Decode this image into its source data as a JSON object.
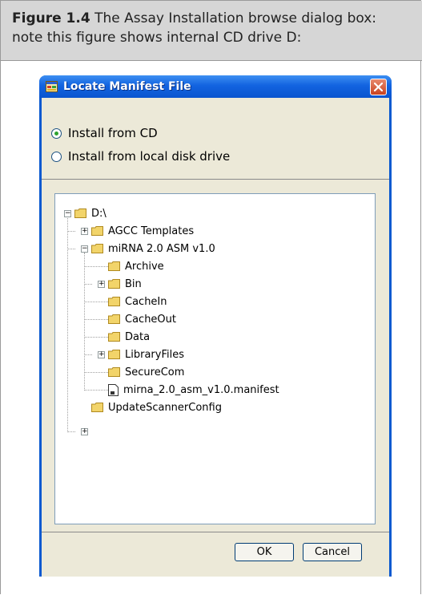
{
  "caption": {
    "label": "Figure 1.4",
    "text": "The Assay Installation browse dialog box: note this figure shows internal CD drive D:"
  },
  "dialog": {
    "title": "Locate Manifest File",
    "radio_options": [
      {
        "label": "Install from CD",
        "checked": true
      },
      {
        "label": "Install from local disk drive",
        "checked": false
      }
    ],
    "tree": {
      "root": "D:\\",
      "items": [
        "AGCC Templates",
        "miRNA 2.0 ASM v1.0",
        "Archive",
        "Bin",
        "CacheIn",
        "CacheOut",
        "Data",
        "LibraryFiles",
        "SecureCom",
        "mirna_2.0_asm_v1.0.manifest",
        "UpdateScannerConfig"
      ]
    },
    "buttons": {
      "ok": "OK",
      "cancel": "Cancel"
    }
  },
  "colors": {
    "titlebar": "#0a5ad0",
    "dialog_bg": "#ece9d8",
    "caption_bg": "#d6d6d6"
  }
}
